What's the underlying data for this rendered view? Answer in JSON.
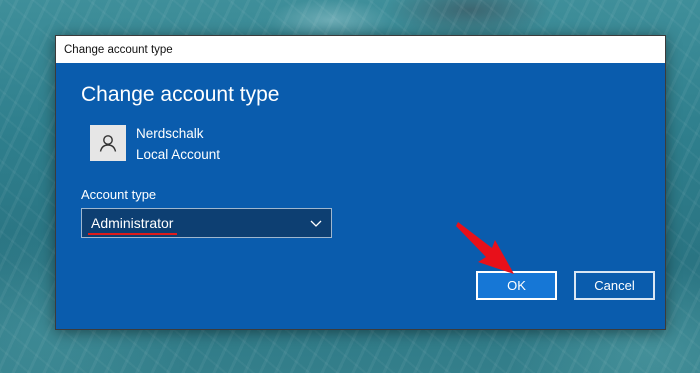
{
  "window": {
    "title": "Change account type"
  },
  "dialog": {
    "heading": "Change account type",
    "user": {
      "name": "Nerdschalk",
      "type": "Local Account",
      "avatar_icon": "user-icon"
    },
    "account_type": {
      "label": "Account type",
      "selected": "Administrator",
      "dropdown_icon": "chevron-down-icon"
    },
    "buttons": {
      "ok": "OK",
      "cancel": "Cancel"
    }
  },
  "annotations": {
    "arrow_color": "#e8101a",
    "underline_color": "#e01b1b"
  },
  "colors": {
    "dialog_background": "#0a5cad",
    "ok_button": "#1677d6"
  }
}
